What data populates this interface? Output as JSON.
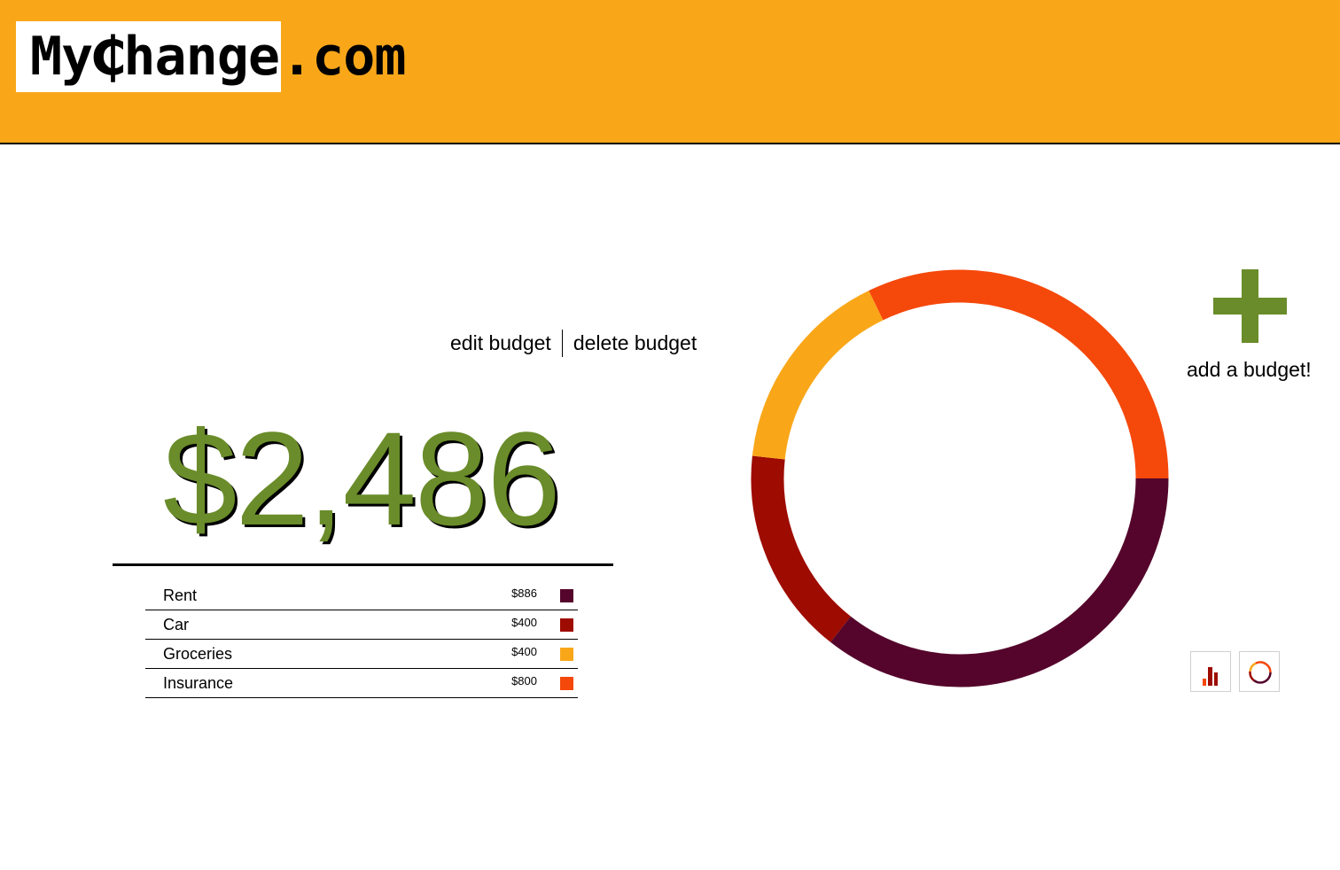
{
  "header": {
    "logo_boxed": "My₵hange",
    "logo_rest": ".com",
    "background": "#f9a719"
  },
  "actions": {
    "edit_label": "edit budget",
    "delete_label": "delete budget"
  },
  "budget": {
    "total": "$2,486",
    "total_color": "#6a8c2a",
    "items": [
      {
        "name": "Rent",
        "amount": "$886",
        "color": "#55052b"
      },
      {
        "name": "Car",
        "amount": "$400",
        "color": "#9e0b00"
      },
      {
        "name": "Groceries",
        "amount": "$400",
        "color": "#f9a719"
      },
      {
        "name": "Insurance",
        "amount": "$800",
        "color": "#f5480b"
      }
    ]
  },
  "add_budget": {
    "label": "add a budget!",
    "icon": "plus-icon",
    "color": "#6a8c2a"
  },
  "view_toggles": [
    {
      "icon": "bar-chart-icon"
    },
    {
      "icon": "donut-chart-icon"
    }
  ],
  "chart_data": {
    "type": "pie",
    "style": "donut",
    "categories": [
      "Rent",
      "Car",
      "Groceries",
      "Insurance"
    ],
    "values": [
      886,
      400,
      400,
      800
    ],
    "colors": [
      "#55052b",
      "#9e0b00",
      "#f9a719",
      "#f5480b"
    ]
  }
}
